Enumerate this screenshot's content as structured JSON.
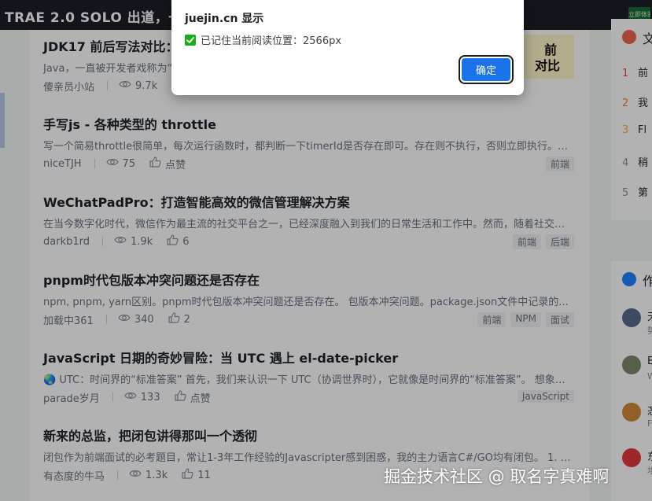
{
  "topbar": {
    "banner_text": "TRAE 2.0  SOLO 出道，一",
    "cta": "立即体验"
  },
  "articles": [
    {
      "title": "JDK17 前后写法对比：",
      "excerpt": "Java，一直被开发者戏称为“",
      "author": "傻亲员小站",
      "views": "9.7k",
      "likes": "",
      "tags": [],
      "thumb": {
        "line1": "前",
        "line2": "对比"
      }
    },
    {
      "title": "手写js - 各种类型的 throttle",
      "excerpt": "写一个简易throttle很简单，每次运行函数时，都判断一下timerId是否存在即可。存在则不执行，否则立即执行。但...",
      "author": "niceTJH",
      "views": "75",
      "likes": "点赞",
      "tags": [
        "前端"
      ]
    },
    {
      "title": "WeChatPadPro：打造智能高效的微信管理解决方案",
      "excerpt": "在当今数字化时代，微信作为最主流的社交平台之一，已经深度融入到我们的日常生活和工作中。然而，随着社交圈...",
      "author": "darkb1rd",
      "views": "1.9k",
      "likes": "6",
      "tags": [
        "前端",
        "后端"
      ]
    },
    {
      "title": "pnpm时代包版本冲突问题还是否存在",
      "excerpt": "npm, pnpm, yarn区别。pnpm时代包版本冲突问题还是否存在。 包版本冲突问题。package.json文件中记录的...",
      "author": "加载中361",
      "views": "340",
      "likes": "2",
      "tags": [
        "前端",
        "NPM",
        "面试"
      ]
    },
    {
      "title": "JavaScript 日期的奇妙冒险：当 UTC 遇上 el-date-picker",
      "excerpt": "🌏 UTC：时间界的“标准答案” 首先，我们来认识一下 UTC（协调世界时），它就像是时间界的“标准答案”。 想象一...",
      "author": "parade岁月",
      "views": "133",
      "likes": "点赞",
      "tags": [
        "JavaScript"
      ]
    },
    {
      "title": "新来的总监，把闭包讲得那叫一个透彻",
      "excerpt": "闭包作为前端面试的必考题目，常让1-3年工作经验的Javascripter感到困惑，我的主力语言C#/GO均有闭包。 1. 闭...",
      "author": "有态度的牛马",
      "views": "1.3k",
      "likes": "11",
      "tags": []
    }
  ],
  "sidebar": {
    "rank_title": "文",
    "rank_items": [
      {
        "num": "1",
        "text": "前",
        "color": "#f04142"
      },
      {
        "num": "2",
        "text": "我",
        "color": "#ff7d23"
      },
      {
        "num": "3",
        "text": "Fl",
        "color": "#ffb02e"
      },
      {
        "num": "4",
        "text": "稍",
        "color": "#8a919f"
      },
      {
        "num": "5",
        "text": "第",
        "color": "#8a919f"
      }
    ],
    "author_title": "作",
    "authors": [
      {
        "name": "天",
        "desc": "势",
        "color": "#5a6b8c"
      },
      {
        "name": "E",
        "desc": "W",
        "color": "#7c8a68"
      },
      {
        "name": "忞",
        "desc": "F",
        "color": "#d08a3c"
      },
      {
        "name": "东",
        "desc": "埃",
        "color": "#e23a3a"
      }
    ]
  },
  "dialog": {
    "title": "juejin.cn 显示",
    "message": "已记住当前阅读位置：2566px",
    "ok_label": "确定"
  },
  "watermark": "掘金技术社区 @ 取名字真难啊"
}
